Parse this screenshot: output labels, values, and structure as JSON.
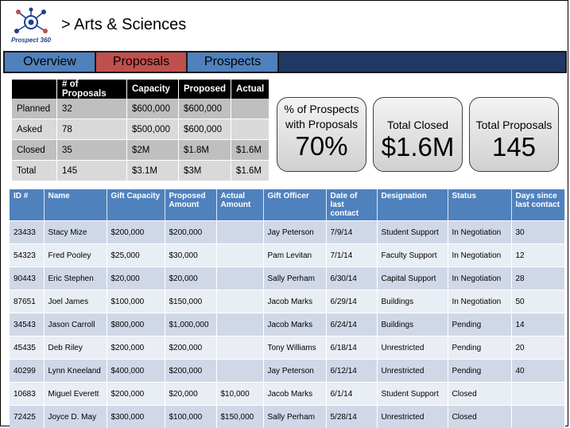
{
  "header": {
    "logo_text": "Prospect 360",
    "title": "> Arts & Sciences"
  },
  "nav": {
    "tabs": [
      {
        "label": "Overview",
        "active": false
      },
      {
        "label": "Proposals",
        "active": true
      },
      {
        "label": "Prospects",
        "active": false
      }
    ]
  },
  "summary": {
    "headers": [
      "",
      "# of Proposals",
      "Capacity",
      "Proposed",
      "Actual"
    ],
    "rows": [
      [
        "Planned",
        "32",
        "$600,000",
        "$600,000",
        ""
      ],
      [
        "Asked",
        "78",
        "$500,000",
        "$600,000",
        ""
      ],
      [
        "Closed",
        "35",
        "$2M",
        "$1.8M",
        "$1.6M"
      ],
      [
        "Total",
        "145",
        "$3.1M",
        "$3M",
        "$1.6M"
      ]
    ]
  },
  "kpis": [
    {
      "label": "% of Prospects with Proposals",
      "value": "70%"
    },
    {
      "label": "Total Closed",
      "value": "$1.6M"
    },
    {
      "label": "Total Proposals",
      "value": "145"
    }
  ],
  "details": {
    "headers": [
      "ID #",
      "Name",
      "Gift Capacity",
      "Proposed Amount",
      "Actual Amount",
      "Gift Officer",
      "Date of last contact",
      "Designation",
      "Status",
      "Days since last contact"
    ],
    "rows": [
      [
        "23433",
        "Stacy Mize",
        "$200,000",
        "$200,000",
        "",
        "Jay Peterson",
        "7/9/14",
        "Student Support",
        "In Negotiation",
        "30"
      ],
      [
        "54323",
        "Fred Pooley",
        "$25,000",
        "$30,000",
        "",
        "Pam Levitan",
        "7/1/14",
        "Faculty Support",
        "In Negotiation",
        "12"
      ],
      [
        "90443",
        "Eric Stephen",
        "$20,000",
        "$20,000",
        "",
        "Sally Perham",
        "6/30/14",
        "Capital Support",
        "In Negotiation",
        "28"
      ],
      [
        "87651",
        "Joel James",
        "$100,000",
        "$150,000",
        "",
        "Jacob Marks",
        "6/29/14",
        "Buildings",
        "In Negotiation",
        "50"
      ],
      [
        "34543",
        "Jason Carroll",
        "$800,000",
        "$1,000,000",
        "",
        "Jacob Marks",
        "6/24/14",
        "Buildings",
        "Pending",
        "14"
      ],
      [
        "45435",
        "Deb Riley",
        "$200,000",
        "$200,000",
        "",
        "Tony Williams",
        "6/18/14",
        "Unrestricted",
        "Pending",
        "20"
      ],
      [
        "40299",
        "Lynn Kneeland",
        "$400,000",
        "$200,000",
        "",
        "Jay Peterson",
        "6/12/14",
        "Unrestricted",
        "Pending",
        "40"
      ],
      [
        "10683",
        "Miguel Everett",
        "$200,000",
        "$20,000",
        "$10,000",
        "Jacob Marks",
        "6/1/14",
        "Student Support",
        "Closed",
        ""
      ],
      [
        "72425",
        "Joyce D. May",
        "$300,000",
        "$100,000",
        "$150,000",
        "Sally Perham",
        "5/28/14",
        "Unrestricted",
        "Closed",
        ""
      ]
    ]
  },
  "colors": {
    "nav_bar": "#1f3864",
    "tab_default": "#4f81bd",
    "tab_active": "#c0504d",
    "table_header": "#4f81bd"
  }
}
